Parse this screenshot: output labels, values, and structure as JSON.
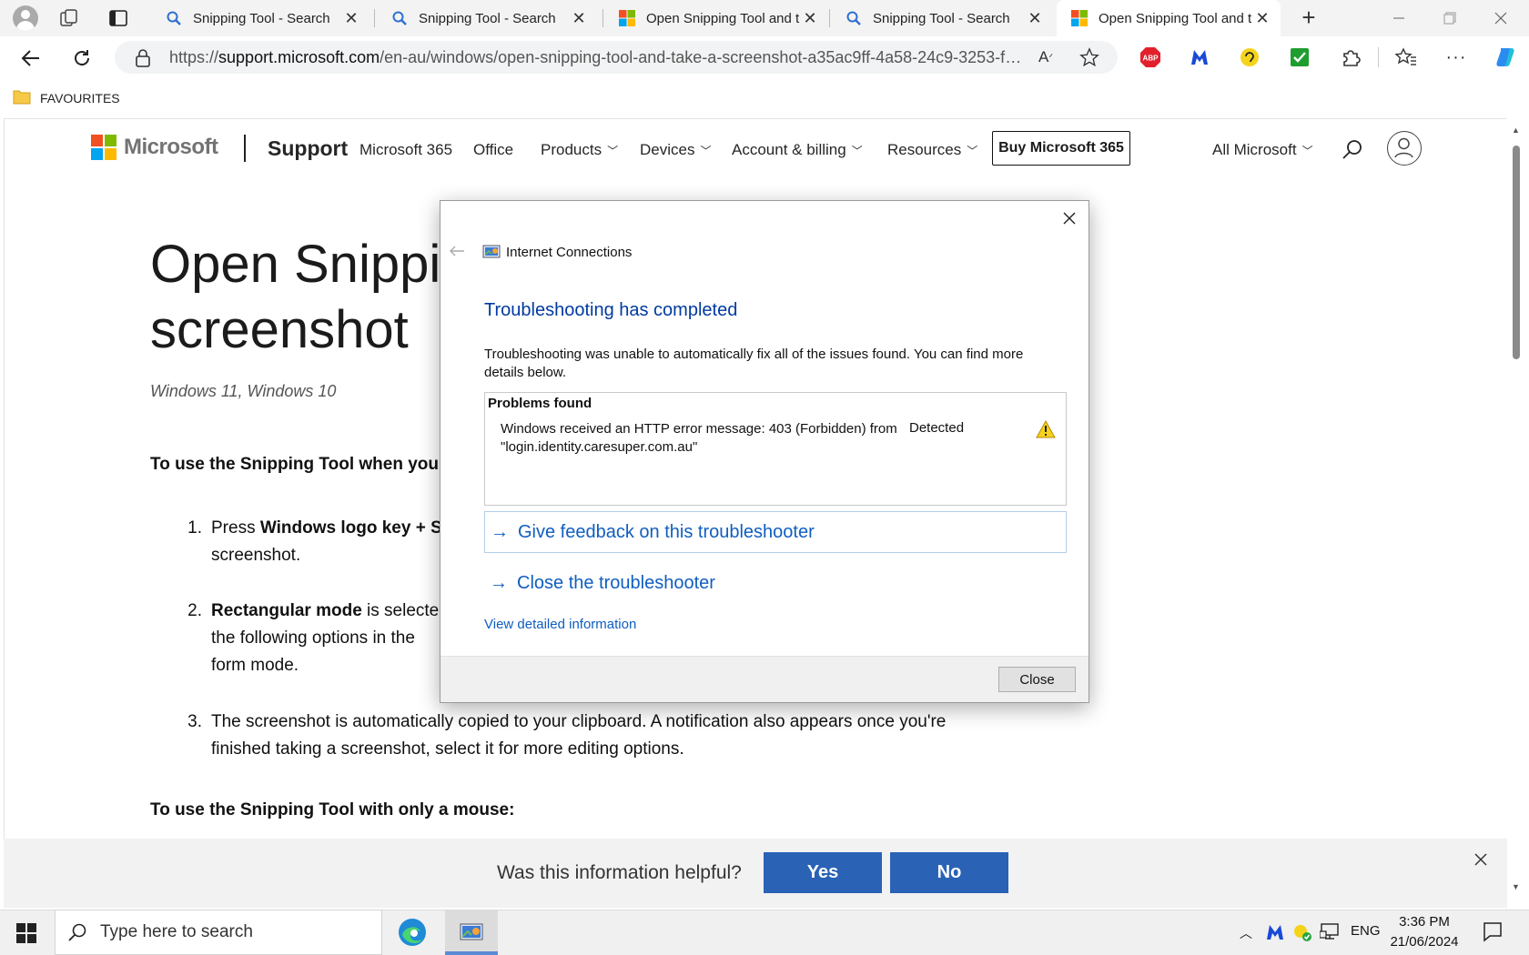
{
  "browser": {
    "tabs": [
      {
        "title": "Snipping Tool - Search",
        "icon": "search-icon"
      },
      {
        "title": "Snipping Tool - Search",
        "icon": "search-icon"
      },
      {
        "title": "Open Snipping Tool and t",
        "icon": "microsoft-logo"
      },
      {
        "title": "Snipping Tool - Search",
        "icon": "search-icon"
      },
      {
        "title": "Open Snipping Tool and t",
        "icon": "microsoft-logo",
        "active": true
      }
    ],
    "url_prefix": "https://",
    "url_host": "support.microsoft.com",
    "url_path": "/en-au/windows/open-snipping-tool-and-take-a-screenshot-a35ac9ff-4a58-24c9-3253-f1...",
    "favourites_label": "FAVOURITES",
    "extensions": [
      "read-aloud-icon",
      "favorite-star-icon",
      "adblock-plus-icon",
      "malwarebytes-icon",
      "ear-icon",
      "checkmark-extension-icon",
      "extensions-puzzle-icon",
      "favorites-icon",
      "more-icon",
      "copilot-icon"
    ]
  },
  "site_header": {
    "brand": "Microsoft",
    "section": "Support",
    "nav": [
      {
        "label": "Microsoft 365",
        "dropdown": false
      },
      {
        "label": "Office",
        "dropdown": false
      },
      {
        "label": "Products",
        "dropdown": true
      },
      {
        "label": "Devices",
        "dropdown": true
      },
      {
        "label": "Account & billing",
        "dropdown": true
      },
      {
        "label": "Resources",
        "dropdown": true
      }
    ],
    "buy_button": "Buy Microsoft 365",
    "all_microsoft": "All Microsoft"
  },
  "article": {
    "title": "Open Snippin\nscreenshot",
    "applies_to": "Windows 11, Windows 10",
    "intro": "To use the Snipping Tool when you h",
    "steps": [
      {
        "num": "1.",
        "lead_bold": "Press ",
        "bold": "Windows logo key + Sh",
        "rest": "",
        "line2": "screenshot."
      },
      {
        "num": "2.",
        "lead_bold": "",
        "bold": "Rectangular mode",
        "rest": " is selecte",
        "line2": "the following options in the",
        "line3": "form mode."
      },
      {
        "num": "3.",
        "lead_bold": "",
        "bold": "",
        "rest": "The screenshot is automatically copied to your clipboard. A notification also appears once you're",
        "line2": "finished taking a screenshot, select it for more editing options."
      }
    ],
    "mouse_heading": "To use the Snipping Tool with only a mouse:"
  },
  "feedback": {
    "question": "Was this information helpful?",
    "yes": "Yes",
    "no": "No"
  },
  "dialog": {
    "window_title": "Internet Connections",
    "heading": "Troubleshooting has completed",
    "description": "Troubleshooting was unable to automatically fix all of the issues found. You can find more details below.",
    "problems_header": "Problems found",
    "problem_text": "Windows received an HTTP error message: 403 (Forbidden) from \"login.identity.caresuper.com.au\"",
    "problem_status": "Detected",
    "link_feedback": "Give feedback on this troubleshooter",
    "link_close": "Close the troubleshooter",
    "view_details": "View detailed information",
    "close_button": "Close"
  },
  "taskbar": {
    "search_placeholder": "Type here to search",
    "language": "ENG",
    "time": "3:36 PM",
    "date": "21/06/2024"
  },
  "colors": {
    "link_blue": "#0f5ec1",
    "heading_blue": "#003aa0",
    "feedback_button": "#2a62b5",
    "ms_red": "#f25022",
    "ms_green": "#7fba00",
    "ms_blue": "#00a4ef",
    "ms_yellow": "#ffb900"
  }
}
